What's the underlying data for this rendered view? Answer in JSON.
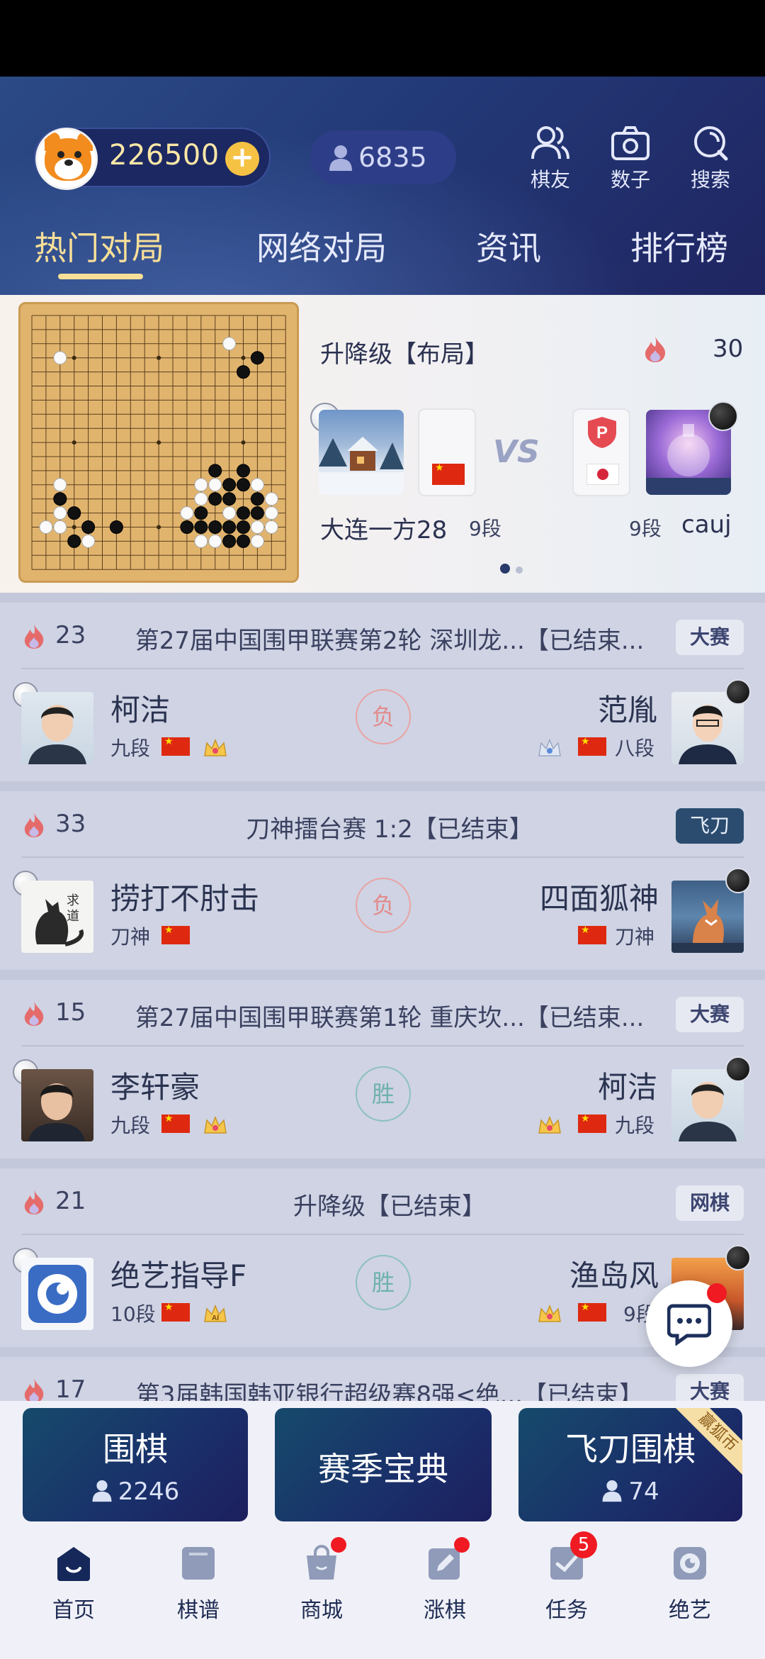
{
  "header": {
    "coins": "226500",
    "online_count": "6835",
    "icons": [
      {
        "label": "棋友",
        "icon": "friends-icon"
      },
      {
        "label": "数子",
        "icon": "camera-icon"
      },
      {
        "label": "搜索",
        "icon": "search-icon"
      }
    ],
    "tabs": [
      "热门对局",
      "网络对局",
      "资讯",
      "排行榜"
    ],
    "active_tab": "热门对局"
  },
  "featured": {
    "title": "升降级【布局】",
    "heat": "30",
    "vs": "VS",
    "left_player": {
      "name": "大连一方28",
      "rank": "9段",
      "flag": "china"
    },
    "right_player": {
      "name": "cauj",
      "rank": "9段",
      "flag": "japan"
    },
    "page_indicator": {
      "current": 1,
      "total": 2
    }
  },
  "games": [
    {
      "heat": "23",
      "title": "第27届中国围甲联赛第2轮 深圳龙...【已结束...",
      "tag": "大赛",
      "left": {
        "name": "柯洁",
        "rank": "九段"
      },
      "right": {
        "name": "范胤",
        "rank": "八段"
      },
      "result": "负"
    },
    {
      "heat": "33",
      "title": "刀神擂台赛 1:2【已结束】",
      "tag": "飞刀",
      "left": {
        "name": "捞打不肘击",
        "rank": "刀神"
      },
      "right": {
        "name": "四面狐神",
        "rank": "刀神"
      },
      "result": "负"
    },
    {
      "heat": "15",
      "title": "第27届中国围甲联赛第1轮 重庆坎...【已结束...",
      "tag": "大赛",
      "left": {
        "name": "李轩豪",
        "rank": "九段"
      },
      "right": {
        "name": "柯洁",
        "rank": "九段"
      },
      "result": "胜"
    },
    {
      "heat": "21",
      "title": "升降级【已结束】",
      "tag": "网棋",
      "left": {
        "name": "绝艺指导F",
        "rank": "10段"
      },
      "right": {
        "name": "渔岛风",
        "rank": "9段"
      },
      "result": "胜"
    },
    {
      "heat": "17",
      "title": "第3届韩国韩亚银行超级赛8强<绝...【已结束】",
      "tag": "大赛"
    }
  ],
  "modes": [
    {
      "title": "围棋",
      "count": "2246"
    },
    {
      "title": "赛季宝典"
    },
    {
      "title": "飞刀围棋",
      "count": "74",
      "ribbon": "赢狐币"
    }
  ],
  "nav": [
    {
      "label": "首页",
      "icon": "home-icon",
      "active": true
    },
    {
      "label": "棋谱",
      "icon": "record-icon"
    },
    {
      "label": "商城",
      "icon": "shop-icon",
      "dot": true
    },
    {
      "label": "涨棋",
      "icon": "pencil-icon",
      "dot": true
    },
    {
      "label": "任务",
      "icon": "task-icon",
      "badge": "5"
    },
    {
      "label": "绝艺",
      "icon": "jueyi-icon"
    }
  ],
  "colors": {
    "accent_gold": "#f8df98",
    "header_blue": "#233a78",
    "lose": "#e38a8a",
    "win": "#6fb1ad"
  }
}
